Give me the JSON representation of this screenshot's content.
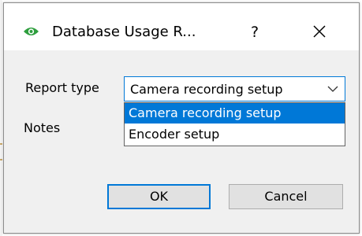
{
  "dialog": {
    "title": "Database Usage R...",
    "help_label": "?",
    "icon": "eye-icon",
    "close_icon": "close-icon"
  },
  "form": {
    "report_type_label": "Report type",
    "notes_label": "Notes",
    "report_type_value": "Camera recording setup"
  },
  "dropdown": {
    "options": [
      {
        "label": "Camera recording setup",
        "selected": true
      },
      {
        "label": "Encoder setup",
        "selected": false
      }
    ]
  },
  "buttons": {
    "ok_label": "OK",
    "cancel_label": "Cancel"
  },
  "colors": {
    "accent": "#0078d7",
    "icon_green": "#2e9e3e",
    "dialog_bg": "#f0f0f0",
    "button_bg": "#e1e1e1"
  }
}
